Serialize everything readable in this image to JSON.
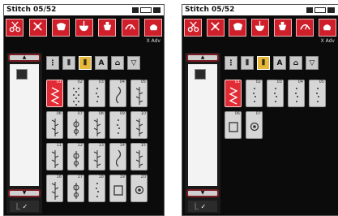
{
  "screens": [
    {
      "title": "Stitch 05/52",
      "tools": [
        {
          "icon": "scissors-icon"
        },
        {
          "icon": "scissors-cross-icon"
        },
        {
          "icon": "stitch-shape-icon"
        },
        {
          "icon": "needle-bowl-icon"
        },
        {
          "icon": "presser-foot-icon"
        },
        {
          "icon": "speed-icon"
        },
        {
          "icon": "settings-icon"
        }
      ],
      "side_label": "X Adv",
      "scroll_up": "▲",
      "scroll_down": "▼",
      "foot_label": "⎿ ✓",
      "categories": [
        {
          "label": "⋮",
          "selected": false
        },
        {
          "label": "⦀",
          "selected": false
        },
        {
          "label": "⦀",
          "selected": true
        },
        {
          "label": "A",
          "selected": false
        },
        {
          "label": "⌂",
          "selected": false
        },
        {
          "label": "▽",
          "selected": false
        }
      ],
      "stitches": [
        {
          "num": "01",
          "pattern": "zigzag",
          "selected": true
        },
        {
          "num": "02",
          "pattern": "dense",
          "selected": false
        },
        {
          "num": "03",
          "pattern": "dots",
          "selected": false
        },
        {
          "num": "04",
          "pattern": "wave",
          "selected": false
        },
        {
          "num": "05",
          "pattern": "leaf",
          "selected": false
        },
        {
          "num": "06",
          "pattern": "leaf",
          "selected": false
        },
        {
          "num": "07",
          "pattern": "flower",
          "selected": false
        },
        {
          "num": "08",
          "pattern": "leaf",
          "selected": false
        },
        {
          "num": "09",
          "pattern": "dots",
          "selected": false
        },
        {
          "num": "10",
          "pattern": "leaf",
          "selected": false
        },
        {
          "num": "11",
          "pattern": "leaf",
          "selected": false
        },
        {
          "num": "12",
          "pattern": "flower",
          "selected": false
        },
        {
          "num": "13",
          "pattern": "leaf",
          "selected": false
        },
        {
          "num": "14",
          "pattern": "wave",
          "selected": false
        },
        {
          "num": "15",
          "pattern": "leaf",
          "selected": false
        },
        {
          "num": "16",
          "pattern": "leaf",
          "selected": false
        },
        {
          "num": "17",
          "pattern": "flower",
          "selected": false
        },
        {
          "num": "18",
          "pattern": "dots",
          "selected": false
        },
        {
          "num": "19",
          "pattern": "square",
          "selected": false
        },
        {
          "num": "20",
          "pattern": "circle",
          "selected": false
        }
      ]
    },
    {
      "title": "Stitch 05/52",
      "tools": [
        {
          "icon": "scissors-icon"
        },
        {
          "icon": "scissors-cross-icon"
        },
        {
          "icon": "stitch-shape-icon"
        },
        {
          "icon": "needle-bowl-icon"
        },
        {
          "icon": "presser-foot-icon"
        },
        {
          "icon": "speed-icon"
        },
        {
          "icon": "settings-icon"
        }
      ],
      "side_label": "X Adv",
      "scroll_up": "▲",
      "scroll_down": "▼",
      "foot_label": "⎿ ✓",
      "categories": [
        {
          "label": "⋮",
          "selected": false
        },
        {
          "label": "⦀",
          "selected": false
        },
        {
          "label": "⦀",
          "selected": true
        },
        {
          "label": "A",
          "selected": false
        },
        {
          "label": "⌂",
          "selected": false
        },
        {
          "label": "▽",
          "selected": false
        }
      ],
      "stitches": [
        {
          "num": "01",
          "pattern": "zigzag",
          "selected": true
        },
        {
          "num": "02",
          "pattern": "dots",
          "selected": false
        },
        {
          "num": "03",
          "pattern": "dots",
          "selected": false
        },
        {
          "num": "04",
          "pattern": "dots",
          "selected": false
        },
        {
          "num": "05",
          "pattern": "dots",
          "selected": false
        },
        {
          "num": "06",
          "pattern": "square",
          "selected": false
        },
        {
          "num": "07",
          "pattern": "circle",
          "selected": false
        }
      ]
    }
  ]
}
